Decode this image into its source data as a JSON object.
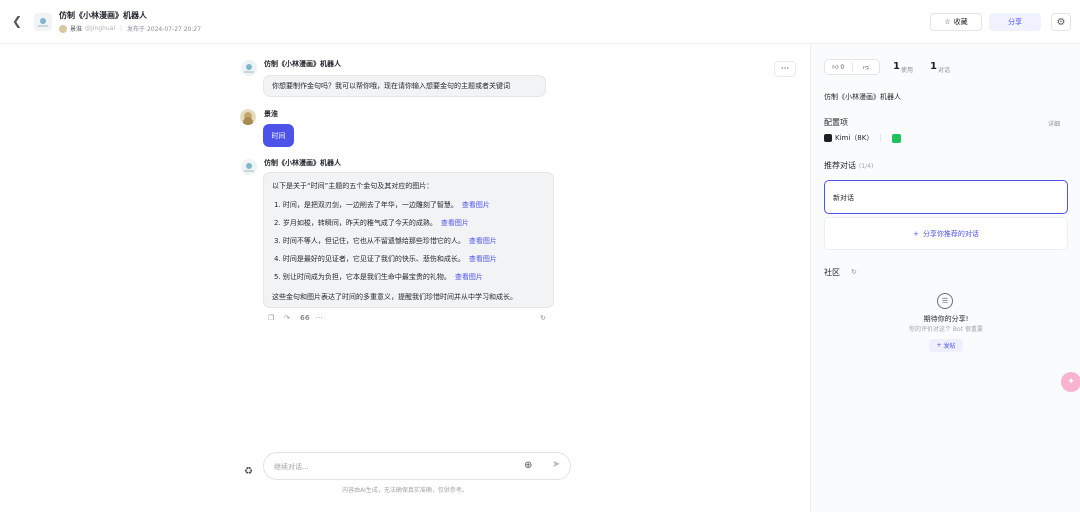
{
  "header": {
    "back_icon": "chevron-left-icon",
    "title": "仿制《小林漫画》机器人",
    "author": "景淮",
    "handle": "@Jinghuai",
    "published": "发布于 2024-07-27 20:27",
    "favorite_label": "收藏",
    "share_label": "分享",
    "settings_icon": "gear-icon"
  },
  "chat": {
    "messages": [
      {
        "role": "bot",
        "name": "仿制《小林漫画》机器人",
        "text": "你想要制作金句吗？我可以帮你哦，现在请你输入想要金句的主题或者关键词"
      },
      {
        "role": "user",
        "name": "景淮",
        "text": "时间"
      },
      {
        "role": "bot",
        "name": "仿制《小林漫画》机器人",
        "intro": "以下是关于“时间”主题的五个金句及其对应的图片：",
        "items": [
          "1. 时间，是把双刃剑，一边削去了年华，一边雕刻了智慧。",
          "2. 岁月如梭，转瞬间，昨天的稚气成了今天的成熟。",
          "3. 时间不等人，但记住，它也从不留遗憾给那些珍惜它的人。",
          "4. 时间是最好的见证者，它见证了我们的快乐、悲伤和成长。",
          "5. 别让时间成为负担，它本是我们生命中最宝贵的礼物。"
        ],
        "link_label": "查看图片",
        "outro": "这些金句和图片表达了时间的多重意义，提醒我们珍惜时间并从中学习和成长。"
      }
    ],
    "more_label": "···",
    "tools": {
      "copy_icon": "copy-icon",
      "share_icon": "share-icon",
      "quote_label": "66",
      "more_label": "···",
      "regenerate_icon": "refresh-icon"
    },
    "input": {
      "placeholder": "继续对话...",
      "value": ""
    },
    "disclaimer": "内容由AI生成，无法确保真实准确，仅供参考。"
  },
  "panel": {
    "likes": "0",
    "uses_count": "1",
    "uses_label": "使用",
    "chats_count": "1",
    "chats_label": "对话",
    "bot_name": "仿制《小林漫画》机器人",
    "config_title": "配置项",
    "detail_label": "详细",
    "model": "Kimi（8K）",
    "recommended_title": "推荐对话",
    "recommended_count": "(1/4)",
    "new_chat": "新对话",
    "share_recommended": "分享你推荐的对话",
    "community_title": "社区",
    "empty_title": "期待你的分享!",
    "empty_sub": "你的评价对这个 Bot 很重要",
    "post_label": "发帖"
  },
  "colors": {
    "accent": "#4d53e8",
    "plugin_green": "#20c05c",
    "float_pink": "#f7b3cf"
  }
}
